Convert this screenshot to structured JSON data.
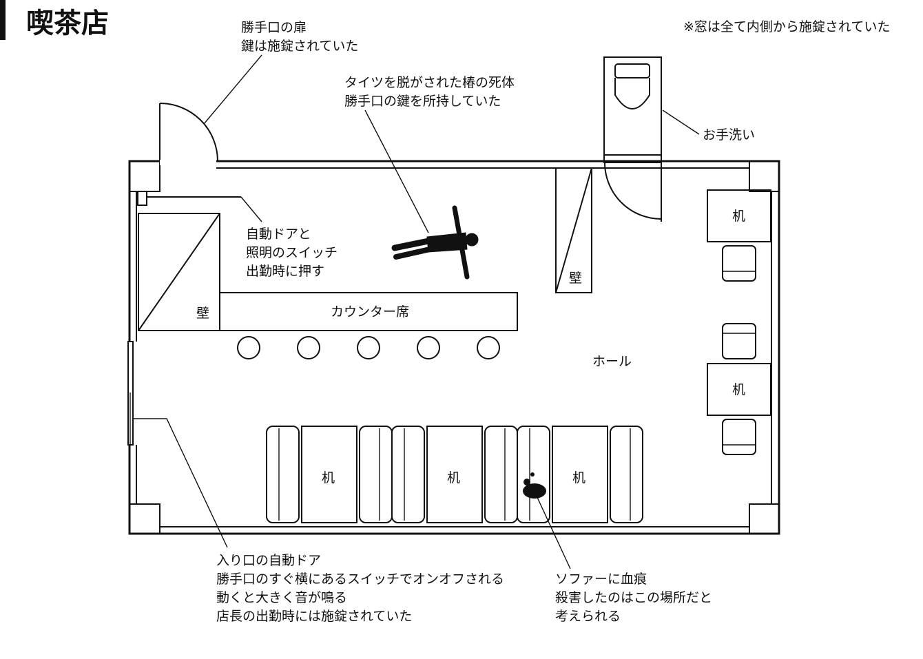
{
  "title": "喫茶店",
  "note": "※窓は全て内側から施錠されていた",
  "labels": {
    "back_door_1": "勝手口の扉",
    "back_door_2": "鍵は施錠されていた",
    "body_1": "タイツを脱がされた椿の死体",
    "body_2": "勝手口の鍵を所持していた",
    "washroom": "お手洗い",
    "switch_1": "自動ドアと",
    "switch_2": "照明のスイッチ",
    "switch_3": "出勤時に押す",
    "wall_left": "壁",
    "wall_right": "壁",
    "counter": "カウンター席",
    "hall": "ホール",
    "desk": "机",
    "entrance_1": "入り口の自動ドア",
    "entrance_2": "勝手口のすぐ横にあるスイッチでオンオフされる",
    "entrance_3": "動くと大きく音が鳴る",
    "entrance_4": "店長の出勤時には施錠されていた",
    "blood_1": "ソファーに血痕",
    "blood_2": "殺害したのはこの場所だと",
    "blood_3": "考えられる"
  }
}
